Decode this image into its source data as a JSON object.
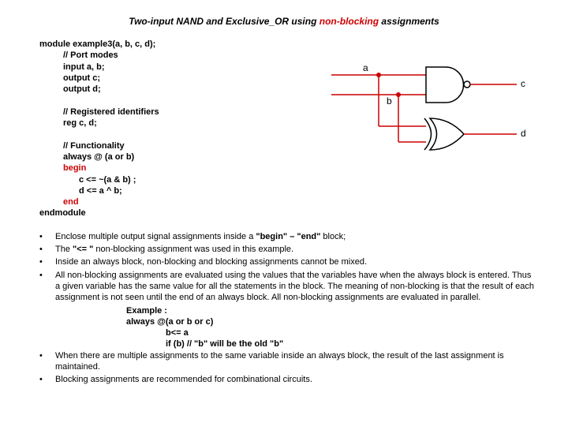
{
  "title": {
    "prefix": "Two-input NAND and Exclusive_OR using ",
    "highlight": "non-blocking",
    "suffix": " assignments"
  },
  "code": {
    "module": "module example3(a, b, c, d);",
    "c1": "// Port modes",
    "in": "input a, b;",
    "outc": "output c;",
    "outd": "output d;",
    "c2": "// Registered identifiers",
    "reg": "reg c, d;",
    "c3": "// Functionality",
    "always": "always @ (a or b)",
    "begin": "begin",
    "s1": "c <= ~(a & b) ;",
    "s2": "d <= a ^ b;",
    "end": "end",
    "endm": "endmodule"
  },
  "notes": {
    "n1a": "Enclose multiple output signal assignments inside a ",
    "n1b": "\"begin\" – \"end\"",
    "n1c": " block;",
    "n2a": "The ",
    "n2b": "\"<= \"",
    "n2c": " non-blocking assignment was used in this example.",
    "n3": "Inside an always block, non-blocking and blocking assignments cannot be mixed.",
    "n4": "All non-blocking assignments are evaluated using the values that the variables have when the always block is entered. Thus a given variable has the same value for all the statements in the block. The meaning of non-blocking is that the result of each assignment is not seen until the end of an always block. All non-blocking assignments are evaluated in parallel.",
    "ex_label": "Example :",
    "ex1": "always @(a or  b or c)",
    "ex2": "b<= a",
    "ex3a": "if (b)   ",
    "ex3b": "// \"b\" will be the old \"b\"",
    "n5": "When there are multiple assignments to the same variable inside an always block, the result of the last assignment is maintained.",
    "n6": "Blocking assignments are recommended for combinational circuits."
  },
  "diagram": {
    "a": "a",
    "b": "b",
    "c": "c",
    "d": "d"
  }
}
